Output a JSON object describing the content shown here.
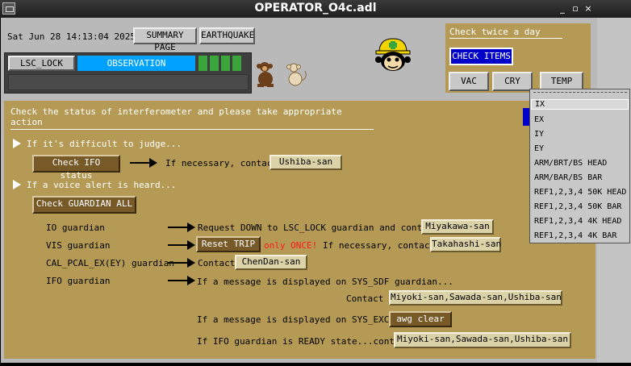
{
  "window": {
    "title": "OPERATOR_O4c.adl",
    "controls": [
      "_",
      "▫",
      "×"
    ]
  },
  "header": {
    "datetime": "Sat Jun 28 14:13:04 2025",
    "summary_label": "SUMMARY PAGE",
    "earthquake_label": "EARTHQUAKE"
  },
  "guardian_status": {
    "lsc_lock": "LSC_LOCK",
    "observation": "OBSERVATION",
    "observation_color": "#00a2ff",
    "indicator_color": "#3aa53a"
  },
  "check_panel": {
    "title": "Check twice a day",
    "items_label": "CHECK ITEMS",
    "vac_label": "VAC",
    "cry_label": "CRY",
    "temp_label": "TEMP"
  },
  "temp_menu": {
    "items": [
      "IX",
      "EX",
      "IY",
      "EY",
      "ARM/BRT/BS HEAD",
      "ARM/BAR/BS BAR",
      "REF1,2,3,4 50K HEAD",
      "REF1,2,3,4 50K BAR",
      "REF1,2,3,4 4K HEAD",
      "REF1,2,3,4 4K BAR"
    ],
    "selected": "IX"
  },
  "main": {
    "title": "Check the status of interferometer and please take appropriate action",
    "difficult_label": "If it's difficult to judge...",
    "check_ifo_label": "Check IFO status",
    "if_necessary_contact": "If necessary, contact",
    "ushiba_label": "Ushiba-san",
    "voice_alert_label": "If a voice alert is heard...",
    "check_guardian_label": "Check GUARDIAN ALL",
    "io_guardian": "IO guardian",
    "io_request": "Request DOWN to LSC_LOCK guardian and contact",
    "miyakawa_label": "Miyakawa-san",
    "vis_guardian": "VIS guardian",
    "reset_trip_label": "Reset TRIP",
    "only_once": "only ONCE!",
    "if_necessary_contact2": "If necessary, contact",
    "takahashi_label": "Takahashi-san",
    "cal_guardian": "CAL_PCAL_EX(EY) guardian",
    "contact": "Contact",
    "chendan_label": "ChenDan-san",
    "ifo_guardian": "IFO guardian",
    "sdf_message": "If a message is displayed on SYS_SDF guardian...",
    "contact2": "Contact",
    "sdf_contacts_label": "Miyoki-san,Sawada-san,Ushiba-san",
    "exc_message": "If a message is displayed on SYS_EXC...",
    "awg_clear_label": "awg clear",
    "ready_message": "If IFO guardian is READY state...contact",
    "ready_contacts_label": "Miyoki-san,Sawada-san,Ushiba-san"
  }
}
